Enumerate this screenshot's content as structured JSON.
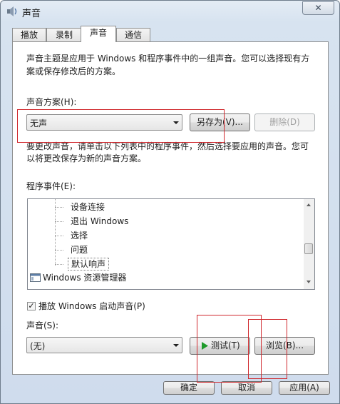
{
  "window": {
    "title": "声音",
    "close_label": "✕"
  },
  "tabs": [
    {
      "label": "播放"
    },
    {
      "label": "录制"
    },
    {
      "label": "声音",
      "active": true
    },
    {
      "label": "通信"
    }
  ],
  "intro_text_line1": "声音主题是应用于 Windows 和程序事件中的一组声音。您可以选择现有方",
  "intro_text_line2": "案或保存修改后的方案。",
  "scheme": {
    "label": "声音方案(H):",
    "selected": "无声",
    "save_as_label": "另存为(V)...",
    "delete_label": "删除(D)"
  },
  "change_text_line1": "要更改声音，请单击以下列表中的程序事件，然后选择要应用的声音。您可",
  "change_text_line2": "以将更改保存为新的声音方案。",
  "events": {
    "label": "程序事件(E):",
    "items": [
      {
        "label": "设备连接"
      },
      {
        "label": "退出 Windows"
      },
      {
        "label": "选择"
      },
      {
        "label": "问题"
      },
      {
        "label": "默认响声"
      },
      {
        "label": "Windows 资源管理器"
      }
    ]
  },
  "startup_sound": {
    "label": "播放 Windows 启动声音(P)",
    "checked": true,
    "check_mark": "✓"
  },
  "sound": {
    "label": "声音(S):",
    "selected": "(无)",
    "test_label": "测试(T)",
    "test_icon": "play-icon",
    "browse_label": "浏览(B)..."
  },
  "footer": {
    "ok_label": "确定",
    "cancel_label": "取消",
    "apply_label": "应用(A)"
  },
  "colors": {
    "annotation_red": "#d0282d",
    "play_green": "#1e9a2a"
  }
}
